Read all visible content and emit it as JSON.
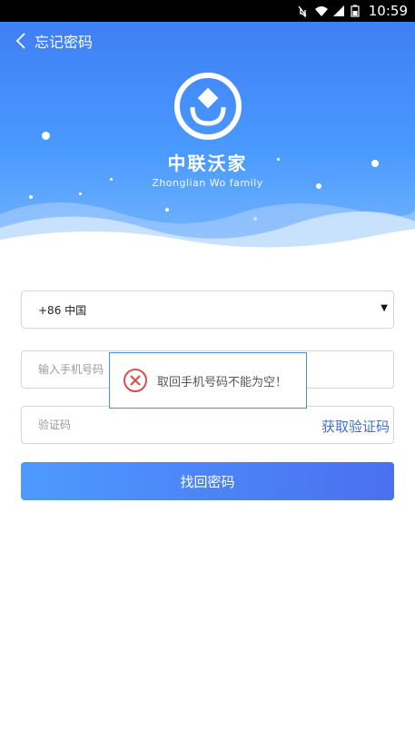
{
  "status_bar": {
    "time": "10:59"
  },
  "nav": {
    "title": "忘记密码"
  },
  "brand": {
    "name": "中联沃家",
    "subtitle": "Zhonglian Wo family"
  },
  "form": {
    "country_value": "+86 中国",
    "phone_placeholder": "输入手机号码",
    "code_placeholder": "验证码",
    "get_code_label": "获取验证码",
    "submit_label": "找回密码"
  },
  "toast": {
    "message": "取回手机号码不能为空！"
  },
  "colors": {
    "accent": "#4a8bf7",
    "link": "#3e6fd8",
    "error": "#e24b4b"
  }
}
